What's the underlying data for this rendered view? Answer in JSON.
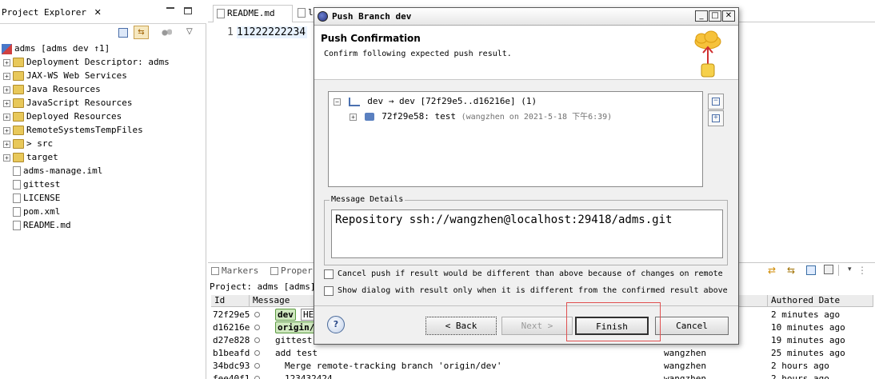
{
  "project_explorer": {
    "title": "Project Explorer",
    "root": "adms  [adms dev ↑1]",
    "items": [
      {
        "label": "Deployment Descriptor: adms",
        "exp": "+",
        "kind": "folder"
      },
      {
        "label": "JAX-WS Web Services",
        "exp": "+",
        "kind": "folder"
      },
      {
        "label": "Java Resources",
        "exp": "+",
        "kind": "folder"
      },
      {
        "label": "JavaScript Resources",
        "exp": "+",
        "kind": "folder"
      },
      {
        "label": "Deployed Resources",
        "exp": "+",
        "kind": "folder"
      },
      {
        "label": "RemoteSystemsTempFiles",
        "exp": "+",
        "kind": "folder"
      },
      {
        "label": "> src",
        "exp": "+",
        "kind": "folder"
      },
      {
        "label": "target",
        "exp": "+",
        "kind": "folder"
      },
      {
        "label": "adms-manage.iml",
        "exp": "",
        "kind": "file"
      },
      {
        "label": "gittest",
        "exp": "",
        "kind": "file"
      },
      {
        "label": "LICENSE",
        "exp": "",
        "kind": "file"
      },
      {
        "label": "pom.xml",
        "exp": "",
        "kind": "file"
      },
      {
        "label": "README.md",
        "exp": "",
        "kind": "file"
      }
    ]
  },
  "editor": {
    "tab1": "README.md",
    "tab2": "l",
    "line_number": "1",
    "line_text": "11222222234"
  },
  "history": {
    "tab_markers": "Markers",
    "tab_properties": "Proper",
    "project_label": "Project: adms [adms]",
    "col_id": "Id",
    "col_message": "Message",
    "col_authored": "Authored Date",
    "rows": [
      {
        "id": "72f29e5",
        "badge": "dev",
        "badge2": "HE",
        "message": "",
        "author": "",
        "date": "2 minutes ago"
      },
      {
        "id": "d16216e",
        "badge": "origin/",
        "badge2": "",
        "message": "",
        "author": "",
        "date": "10 minutes ago"
      },
      {
        "id": "d27e828",
        "badge": "",
        "badge2": "",
        "message": "gittest",
        "author": "",
        "date": "19 minutes ago"
      },
      {
        "id": "b1beafd",
        "badge": "",
        "badge2": "",
        "message": "add test",
        "author": "wangzhen",
        "date": "25 minutes ago"
      },
      {
        "id": "34bdc93",
        "badge": "",
        "badge2": "",
        "message": "Merge remote-tracking branch 'origin/dev'",
        "author": "wangzhen",
        "date": "2 hours ago"
      },
      {
        "id": "fee40f1",
        "badge": "",
        "badge2": "",
        "message": "123432424",
        "author": "wangzhen",
        "date": "2 hours ago"
      }
    ]
  },
  "dialog": {
    "title": "Push Branch dev",
    "heading": "Push Confirmation",
    "subheading": "Confirm following expected push result.",
    "ref_line": "dev → dev [72f29e5..d16216e] (1)",
    "commit_id": "72f29e58: test",
    "commit_meta": "(wangzhen on 2021-5-18 下午6:39)",
    "message_details_label": "Message Details",
    "message_details": "Repository ssh://wangzhen@localhost:29418/adms.git",
    "chk1": "Cancel push if result would be different than above because of changes on remote",
    "chk2": "Show dialog with result only when it is different from the confirmed result above",
    "back": "< Back",
    "next": "Next >",
    "finish": "Finish",
    "cancel": "Cancel",
    "help": "?"
  },
  "colors": {
    "highlight_red": "#e05050",
    "badge_green": "#cfe8bf"
  }
}
